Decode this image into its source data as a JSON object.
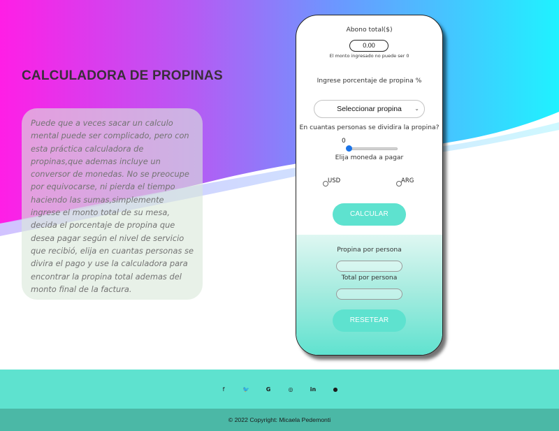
{
  "page": {
    "title": "CALCULADORA DE PROPINAS",
    "description": "Puede que a veces sacar un calculo mental puede ser complicado, pero con esta práctica calculadora de propinas,que ademas incluye un conversor de monedas. No se preocupe por equivocarse, ni pierda el tiempo haciendo las sumas,simplemente ingrese el monto total de su mesa, decida el porcentaje de propina que desea pagar según el nivel de servicio que recibió, elija en cuantas personas se divira el pago y use la calculadora para encontrar la propina total ademas del monto final de la factura."
  },
  "calculator": {
    "amount_label": "Abono total($)",
    "amount_value": "0.00",
    "amount_hint": "El monto ingresado no puede ser 0",
    "percent_label": "Ingrese porcentaje de propina %",
    "percent_select": "Seleccionar propina",
    "people_label": "En cuantas personas se dividira la propina?",
    "people_value": "0",
    "currency_label": "Elija moneda a pagar",
    "currency_options": [
      "USD",
      "ARG"
    ],
    "calculate_button": "CALCULAR",
    "tip_per_person_label": "Propina por persona",
    "total_per_person_label": "Total por persona",
    "reset_button": "RESETEAR"
  },
  "footer": {
    "social_icons": [
      "facebook-icon",
      "twitter-icon",
      "google-icon",
      "instagram-icon",
      "linkedin-icon",
      "github-icon"
    ],
    "social_glyphs": [
      "f",
      "🐦",
      "G",
      "◎",
      "in",
      "●"
    ],
    "copyright": "© 2022 Copyright: Micaela Pedemonti"
  },
  "colors": {
    "accent": "#5ee2cf",
    "footer_bottom": "#4bb8a6",
    "gradient_left": "#ff1ee6",
    "gradient_right": "#1ff2ff"
  }
}
